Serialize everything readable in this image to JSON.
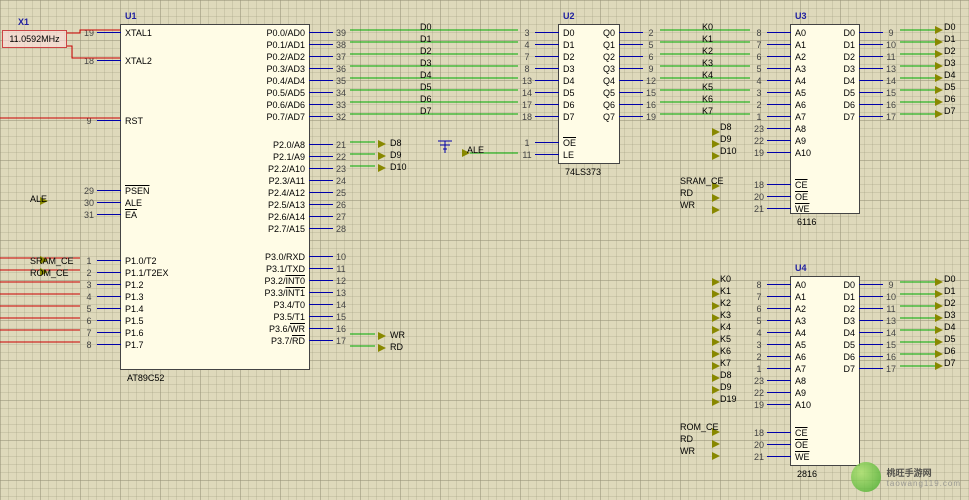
{
  "crystal": {
    "ref": "X1",
    "value": "11.0592MHz"
  },
  "global_nets": [
    "ALE",
    "SRAM_CE",
    "ROM_CE",
    "WR",
    "RD",
    "D8",
    "D9",
    "D10"
  ],
  "watermark": {
    "name": "桃旺手游网",
    "url": "taowang119.com"
  },
  "components": {
    "U1": {
      "ref": "U1",
      "part": "AT89C52",
      "left_pins": [
        {
          "num": "19",
          "name": "XTAL1"
        },
        {
          "num": "18",
          "name": "XTAL2"
        },
        {
          "num": "9",
          "name": "RST"
        },
        {
          "num": "29",
          "name": "PSEN",
          "bar": true
        },
        {
          "num": "30",
          "name": "ALE"
        },
        {
          "num": "31",
          "name": "EA",
          "bar": true
        },
        {
          "num": "1",
          "name": "P1.0/T2"
        },
        {
          "num": "2",
          "name": "P1.1/T2EX"
        },
        {
          "num": "3",
          "name": "P1.2"
        },
        {
          "num": "4",
          "name": "P1.3"
        },
        {
          "num": "5",
          "name": "P1.4"
        },
        {
          "num": "6",
          "name": "P1.5"
        },
        {
          "num": "7",
          "name": "P1.6"
        },
        {
          "num": "8",
          "name": "P1.7"
        }
      ],
      "right_pins": [
        {
          "num": "39",
          "name": "P0.0/AD0"
        },
        {
          "num": "38",
          "name": "P0.1/AD1"
        },
        {
          "num": "37",
          "name": "P0.2/AD2"
        },
        {
          "num": "36",
          "name": "P0.3/AD3"
        },
        {
          "num": "35",
          "name": "P0.4/AD4"
        },
        {
          "num": "34",
          "name": "P0.5/AD5"
        },
        {
          "num": "33",
          "name": "P0.6/AD6"
        },
        {
          "num": "32",
          "name": "P0.7/AD7"
        },
        {
          "num": "21",
          "name": "P2.0/A8"
        },
        {
          "num": "22",
          "name": "P2.1/A9"
        },
        {
          "num": "23",
          "name": "P2.2/A10"
        },
        {
          "num": "24",
          "name": "P2.3/A11"
        },
        {
          "num": "25",
          "name": "P2.4/A12"
        },
        {
          "num": "26",
          "name": "P2.5/A13"
        },
        {
          "num": "27",
          "name": "P2.6/A14"
        },
        {
          "num": "28",
          "name": "P2.7/A15"
        },
        {
          "num": "10",
          "name": "P3.0/RXD"
        },
        {
          "num": "11",
          "name": "P3.1/TXD"
        },
        {
          "num": "12",
          "name": "P3.2/INT0",
          "bar_part": "INT0"
        },
        {
          "num": "13",
          "name": "P3.3/INT1",
          "bar_part": "INT1"
        },
        {
          "num": "14",
          "name": "P3.4/T0"
        },
        {
          "num": "15",
          "name": "P3.5/T1"
        },
        {
          "num": "16",
          "name": "P3.6/WR",
          "bar_part": "WR"
        },
        {
          "num": "17",
          "name": "P3.7/RD",
          "bar_part": "RD"
        }
      ],
      "p0_nets": [
        "D0",
        "D1",
        "D2",
        "D3",
        "D4",
        "D5",
        "D6",
        "D7"
      ]
    },
    "U2": {
      "ref": "U2",
      "part": "74LS373",
      "left_pins": [
        {
          "num": "3",
          "name": "D0"
        },
        {
          "num": "4",
          "name": "D1"
        },
        {
          "num": "7",
          "name": "D2"
        },
        {
          "num": "8",
          "name": "D3"
        },
        {
          "num": "13",
          "name": "D4"
        },
        {
          "num": "14",
          "name": "D5"
        },
        {
          "num": "17",
          "name": "D6"
        },
        {
          "num": "18",
          "name": "D7"
        },
        {
          "num": "1",
          "name": "OE",
          "bar": true
        },
        {
          "num": "11",
          "name": "LE"
        }
      ],
      "right_pins": [
        {
          "num": "2",
          "name": "Q0"
        },
        {
          "num": "5",
          "name": "Q1"
        },
        {
          "num": "6",
          "name": "Q2"
        },
        {
          "num": "9",
          "name": "Q3"
        },
        {
          "num": "12",
          "name": "Q4"
        },
        {
          "num": "15",
          "name": "Q5"
        },
        {
          "num": "16",
          "name": "Q6"
        },
        {
          "num": "19",
          "name": "Q7"
        }
      ],
      "q_nets": [
        "K0",
        "K1",
        "K2",
        "K3",
        "K4",
        "K5",
        "K6",
        "K7"
      ],
      "le_net": "ALE"
    },
    "U3": {
      "ref": "U3",
      "part": "6116",
      "addr_pins": [
        {
          "num": "8",
          "name": "A0"
        },
        {
          "num": "7",
          "name": "A1"
        },
        {
          "num": "6",
          "name": "A2"
        },
        {
          "num": "5",
          "name": "A3"
        },
        {
          "num": "4",
          "name": "A4"
        },
        {
          "num": "3",
          "name": "A5"
        },
        {
          "num": "2",
          "name": "A6"
        },
        {
          "num": "1",
          "name": "A7"
        },
        {
          "num": "23",
          "name": "A8"
        },
        {
          "num": "22",
          "name": "A9"
        },
        {
          "num": "19",
          "name": "A10"
        }
      ],
      "ctrl_pins": [
        {
          "num": "18",
          "name": "CE",
          "bar": true
        },
        {
          "num": "20",
          "name": "OE",
          "bar": true
        },
        {
          "num": "21",
          "name": "WE",
          "bar": true
        }
      ],
      "data_pins": [
        {
          "num": "9",
          "name": "D0"
        },
        {
          "num": "10",
          "name": "D1"
        },
        {
          "num": "11",
          "name": "D2"
        },
        {
          "num": "13",
          "name": "D3"
        },
        {
          "num": "14",
          "name": "D4"
        },
        {
          "num": "15",
          "name": "D5"
        },
        {
          "num": "16",
          "name": "D6"
        },
        {
          "num": "17",
          "name": "D7"
        }
      ],
      "addr_nets_high": [
        "D8",
        "D9",
        "D10"
      ],
      "ctrl_nets": [
        "SRAM_CE",
        "RD",
        "WR"
      ]
    },
    "U4": {
      "ref": "U4",
      "part": "2816",
      "addr_pins": [
        {
          "num": "8",
          "name": "A0"
        },
        {
          "num": "7",
          "name": "A1"
        },
        {
          "num": "6",
          "name": "A2"
        },
        {
          "num": "5",
          "name": "A3"
        },
        {
          "num": "4",
          "name": "A4"
        },
        {
          "num": "3",
          "name": "A5"
        },
        {
          "num": "2",
          "name": "A6"
        },
        {
          "num": "1",
          "name": "A7"
        },
        {
          "num": "23",
          "name": "A8"
        },
        {
          "num": "22",
          "name": "A9"
        },
        {
          "num": "19",
          "name": "A10"
        }
      ],
      "addr_nets": [
        "K0",
        "K1",
        "K2",
        "K3",
        "K4",
        "K5",
        "K6",
        "K7",
        "D8",
        "D9",
        "D19"
      ],
      "ctrl_pins": [
        {
          "num": "18",
          "name": "CE",
          "bar": true
        },
        {
          "num": "20",
          "name": "OE",
          "bar": true
        },
        {
          "num": "21",
          "name": "WE",
          "bar": true
        }
      ],
      "ctrl_nets": [
        "ROM_CE",
        "RD",
        "WR"
      ],
      "data_pins": [
        {
          "num": "9",
          "name": "D0"
        },
        {
          "num": "10",
          "name": "D1"
        },
        {
          "num": "11",
          "name": "D2"
        },
        {
          "num": "13",
          "name": "D3"
        },
        {
          "num": "14",
          "name": "D4"
        },
        {
          "num": "15",
          "name": "D5"
        },
        {
          "num": "16",
          "name": "D6"
        },
        {
          "num": "17",
          "name": "D7"
        }
      ]
    }
  }
}
